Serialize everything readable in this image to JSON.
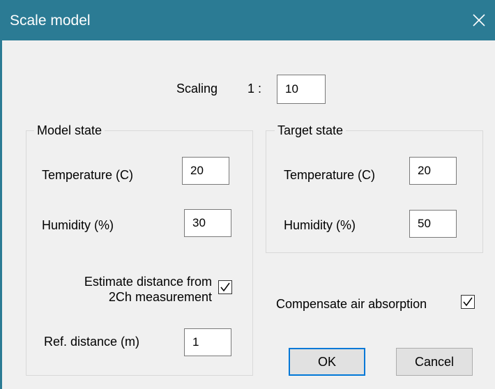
{
  "window": {
    "title": "Scale model",
    "close_icon": "close-icon"
  },
  "scaling": {
    "label": "Scaling",
    "prefix": "1 :",
    "value": "10"
  },
  "model_state": {
    "title": "Model state",
    "temperature_label": "Temperature (C)",
    "temperature_value": "20",
    "humidity_label": "Humidity (%)",
    "humidity_value": "30",
    "estimate_line1": "Estimate distance from",
    "estimate_line2": "2Ch measurement",
    "estimate_checked": true,
    "ref_distance_label": "Ref. distance (m)",
    "ref_distance_value": "1"
  },
  "target_state": {
    "title": "Target state",
    "temperature_label": "Temperature (C)",
    "temperature_value": "20",
    "humidity_label": "Humidity (%)",
    "humidity_value": "50"
  },
  "compensate": {
    "label": "Compensate air absorption",
    "checked": true
  },
  "buttons": {
    "ok": "OK",
    "cancel": "Cancel"
  },
  "colors": {
    "titlebar": "#2b7b94",
    "background": "#f0f0f0",
    "default_button_border": "#0078d7"
  }
}
